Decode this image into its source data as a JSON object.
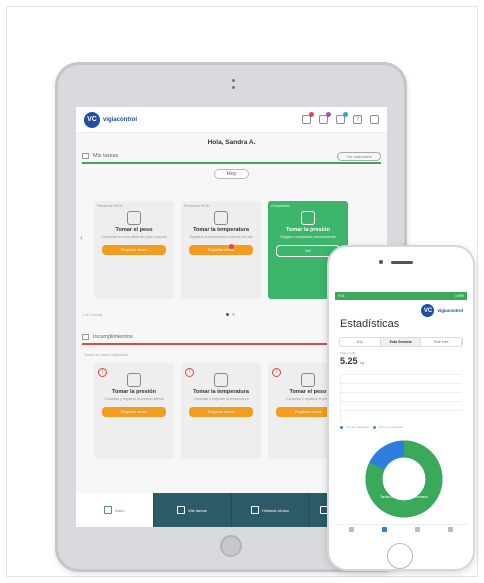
{
  "app": {
    "logo_initials": "VC",
    "logo_text": "vigiacontrol",
    "brand_color": "#1f4fa3",
    "accent_green": "#3aaa5a",
    "accent_orange": "#f39c1f",
    "alert_red": "#e4454f"
  },
  "tablet": {
    "top_icons": [
      {
        "icon": "calendar-icon",
        "badge_color": "#e4454f"
      },
      {
        "icon": "warning-icon",
        "badge_color": "#9b59b6"
      },
      {
        "icon": "chat-icon",
        "badge_color": "#1ab0c9"
      },
      {
        "icon": "help-icon",
        "glyph": "?"
      },
      {
        "icon": "user-icon"
      }
    ],
    "greeting": "Hola, Sandra A.",
    "tasks_section": {
      "title": "Mis tareas",
      "button": "Ver calendario",
      "day_label": "Hoy",
      "cards": [
        {
          "sub": "Pendiente 08:00",
          "title": "Tomar el peso",
          "desc": "Completar la toma diaria del peso corporal",
          "button": "Registrar ahora"
        },
        {
          "sub": "Pendiente 09:00",
          "title": "Tomar la temperatura",
          "desc": "Registrar la temperatura corporal del día",
          "button": "Registrar ahora"
        },
        {
          "sub": "Completado",
          "title": "Tomar la presión",
          "desc": "Registro completado correctamente",
          "button": "Ver"
        }
      ],
      "pager_text": "1 de 3 tareas"
    },
    "followup_section": {
      "title": "Incumplimientos",
      "button": "Ver todos",
      "note": "Tareas sin datos registrados",
      "cards": [
        {
          "title": "Tomar la presión",
          "desc": "Consultar y registrar la presión arterial",
          "button": "Registrar ahora"
        },
        {
          "title": "Tomar la temperatura",
          "desc": "Consultar y registrar la temperatura",
          "button": "Registrar ahora"
        },
        {
          "title": "Tomar el peso",
          "desc": "Consultar y registrar el peso",
          "button": "Registrar ahora"
        }
      ]
    },
    "tabs": [
      {
        "label": "Inicio",
        "icon": "home-icon"
      },
      {
        "label": "Mis tareas",
        "icon": "tasks-icon"
      },
      {
        "label": "Historial clínico",
        "icon": "clipboard-icon"
      },
      {
        "label": "Informes de seguimiento",
        "icon": "report-icon"
      }
    ]
  },
  "phone": {
    "status_time": "9:41",
    "status_right": "100%",
    "title": "Estadísticas",
    "segments": [
      "Hoy",
      "Esta Semana",
      "Este mes"
    ],
    "active_segment": "Esta Semana",
    "metric_label": "Peso medio",
    "metric_value": "5.25",
    "metric_unit": "kg",
    "legend": [
      "Tareas realizadas",
      "Tareas pendientes"
    ],
    "donut_label": "Tareas completadas esta semana",
    "donut": {
      "completed_fraction": 0.82,
      "completed_color": "#3aaa5a",
      "pending_color": "#2f7de1"
    }
  }
}
